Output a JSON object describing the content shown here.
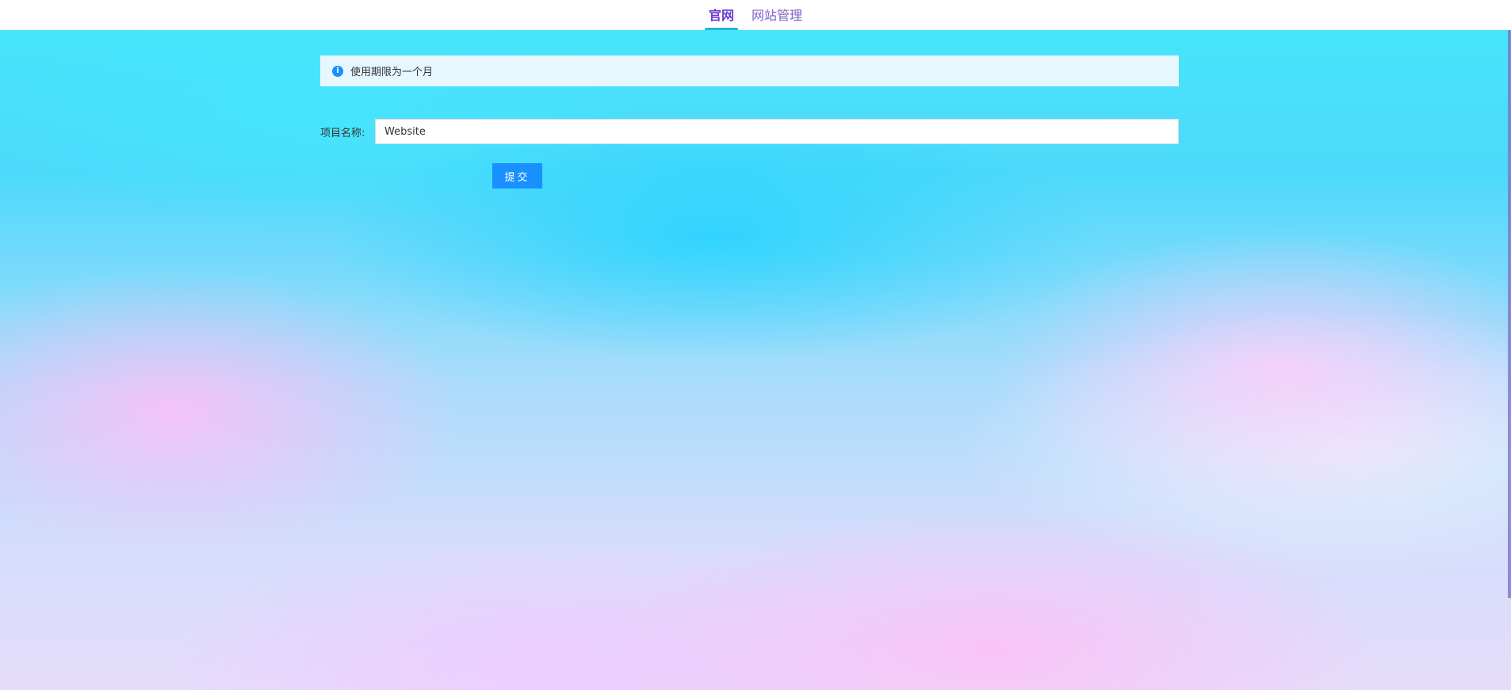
{
  "nav": {
    "tabs": [
      {
        "label": "官网",
        "active": true
      },
      {
        "label": "网站管理",
        "active": false
      }
    ]
  },
  "alert": {
    "icon": "info-icon",
    "message": "使用期限为一个月"
  },
  "form": {
    "project_name_label": "项目名称:",
    "project_name_value": "Website",
    "submit_label": "提交"
  },
  "colors": {
    "accent": "#1890ff",
    "nav_active": "#6a3bd1",
    "nav_underline": "#1fb7d7",
    "alert_bg": "#e6f7ff"
  }
}
